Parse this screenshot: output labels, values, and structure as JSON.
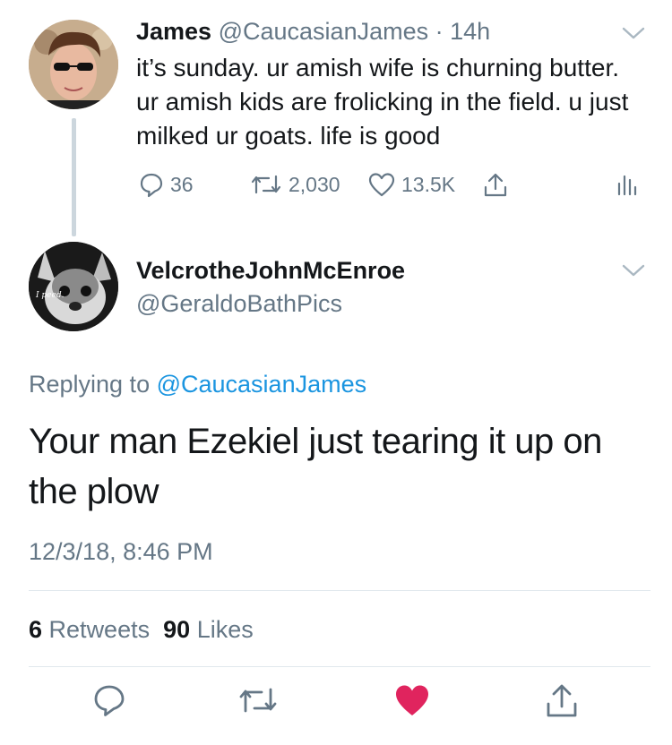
{
  "original_tweet": {
    "name": "James",
    "handle": "@CaucasianJames",
    "separator": " · ",
    "time": "14h",
    "text": "it’s sunday. ur amish wife is churning butter. ur amish kids are frolicking in the field. u just milked ur goats. life is good",
    "actions": {
      "replies": "36",
      "retweets": "2,030",
      "likes": "13.5K"
    }
  },
  "reply_tweet": {
    "name": "VelcrotheJohnMcEnroe",
    "handle": "@GeraldoBathPics",
    "avatar_caption": "I peed.",
    "replying_prefix": "Replying to ",
    "replying_to": "@CaucasianJames",
    "text": "Your man Ezekiel just tearing it up on the plow",
    "timestamp": "12/3/18, 8:46 PM",
    "stats": {
      "retweet_count": "6",
      "retweet_label": "Retweets",
      "like_count": "90",
      "like_label": "Likes"
    },
    "liked": true
  },
  "colors": {
    "secondary_text": "#657786",
    "link": "#1b95e0",
    "like_red": "#e0245e",
    "divider": "#e1e8ed",
    "thread_line": "#ccd6dd"
  },
  "icons": {
    "reply": "reply-icon",
    "retweet": "retweet-icon",
    "like": "heart-icon",
    "share": "share-icon",
    "analytics": "analytics-icon",
    "menu": "chevron-down-icon"
  }
}
